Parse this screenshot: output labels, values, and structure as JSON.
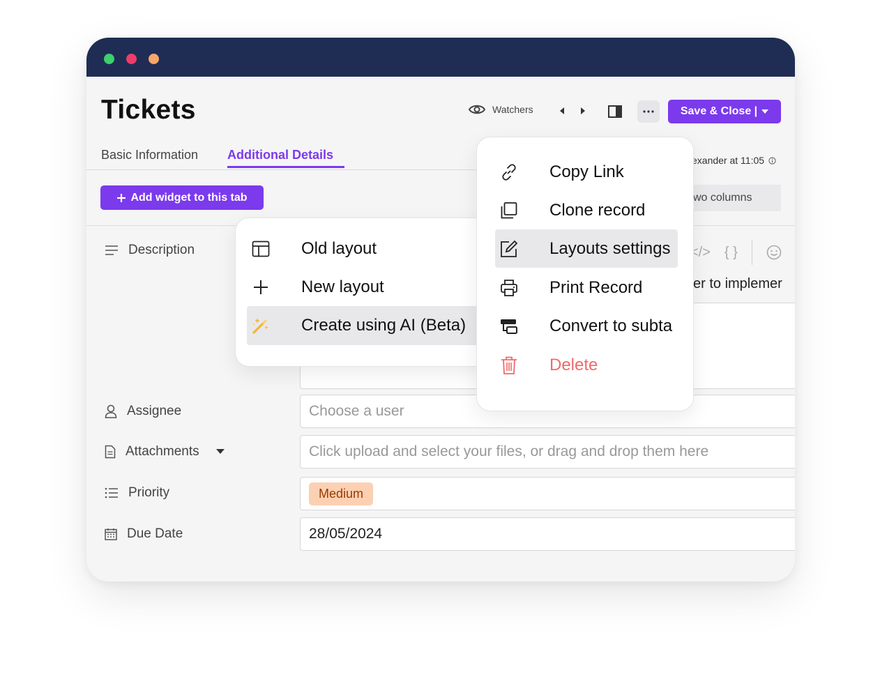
{
  "header": {
    "title": "Tickets",
    "watchers_label": "Watchers",
    "save_label": "Save & Close |"
  },
  "tabs": [
    {
      "label": "Basic Information",
      "active": false
    },
    {
      "label": "Additional Details",
      "active": true
    }
  ],
  "toolbar": {
    "add_widget_label": "Add widget to this tab"
  },
  "meta": {
    "edited_by": "exander at 11:05",
    "layout_option": "wo columns"
  },
  "description": {
    "visible_text": "er to implemer"
  },
  "fields": {
    "description_label": "Description",
    "assignee_label": "Assignee",
    "assignee_placeholder": "Choose a user",
    "attachments_label": "Attachments",
    "attachments_placeholder": "Click upload and select your files, or drag and drop them here",
    "priority_label": "Priority",
    "priority_value": "Medium",
    "due_date_label": "Due Date",
    "due_date_value": "28/05/2024"
  },
  "layout_menu": {
    "items": [
      {
        "label": "Old layout",
        "icon": "layout-icon"
      },
      {
        "label": "New layout",
        "icon": "plus-icon"
      },
      {
        "label": "Create using AI (Beta)",
        "icon": "magic-wand-icon",
        "highlighted": true
      }
    ]
  },
  "more_menu": {
    "items": [
      {
        "label": "Copy Link",
        "icon": "link-icon"
      },
      {
        "label": "Clone record",
        "icon": "clone-icon"
      },
      {
        "label": "Layouts settings",
        "icon": "edit-icon",
        "highlighted": true
      },
      {
        "label": "Print Record",
        "icon": "printer-icon"
      },
      {
        "label": "Convert to subta",
        "icon": "convert-icon"
      },
      {
        "label": "Delete",
        "icon": "trash-icon",
        "color": "#f06a6a"
      }
    ]
  },
  "colors": {
    "accent": "#7c3aed",
    "titlebar": "#1f2d55",
    "danger": "#f06a6a",
    "badge_bg": "#fcd0b2"
  }
}
